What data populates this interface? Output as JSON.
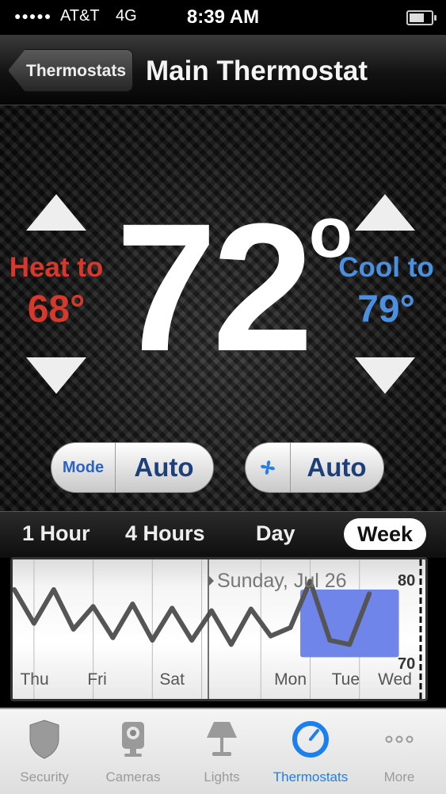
{
  "status_bar": {
    "signal": "●●●●●",
    "carrier": "AT&T",
    "network": "4G",
    "time": "8:39 AM",
    "battery_level": 0.7
  },
  "nav": {
    "back_label": "Thermostats",
    "title": "Main Thermostat"
  },
  "thermostat": {
    "current_temp": "72",
    "degree_symbol": "o",
    "heat_label": "Heat to",
    "heat_value": "68°",
    "cool_label": "Cool to",
    "cool_value": "79°",
    "mode_label": "Mode",
    "mode_value": "Auto",
    "fan_value": "Auto",
    "colors": {
      "heat": "#d6392b",
      "cool": "#4a8fe0"
    }
  },
  "range_tabs": {
    "items": [
      "1 Hour",
      "4 Hours",
      "Day",
      "Week"
    ],
    "selected": "Week"
  },
  "chart_data": {
    "type": "line",
    "date_label": "Sunday, Jul 26",
    "x_tick_labels": [
      "Thu",
      "Fri",
      "Sat",
      "Mon",
      "Tue",
      "Wed"
    ],
    "y_tick_labels": [
      "80",
      "70"
    ],
    "ylim": [
      69,
      81
    ],
    "xlim": [
      0,
      20
    ],
    "series": [
      {
        "x": [
          0,
          1,
          2,
          3,
          4,
          5,
          6,
          7,
          8,
          9,
          10,
          11,
          12,
          13,
          14,
          15,
          16,
          17,
          18
        ],
        "values": [
          79.5,
          75.5,
          79.5,
          74.8,
          77.5,
          73.8,
          77.8,
          73.5,
          77.3,
          73.5,
          77.0,
          73.0,
          77.2,
          74.0,
          75.0,
          80.5,
          73.5,
          73.0,
          79.0
        ]
      }
    ],
    "highlight_range_x": [
      14.5,
      19.5
    ],
    "highlight_range_y": [
      71.5,
      79.5
    ],
    "colors": {
      "line": "#555555",
      "highlight": "#6f85ea"
    }
  },
  "tab_bar": {
    "items": [
      {
        "label": "Security",
        "icon": "shield-icon"
      },
      {
        "label": "Cameras",
        "icon": "camera-icon"
      },
      {
        "label": "Lights",
        "icon": "lamp-icon"
      },
      {
        "label": "Thermostats",
        "icon": "thermostat-icon"
      },
      {
        "label": "More",
        "icon": "more-icon"
      }
    ],
    "selected": "Thermostats"
  }
}
